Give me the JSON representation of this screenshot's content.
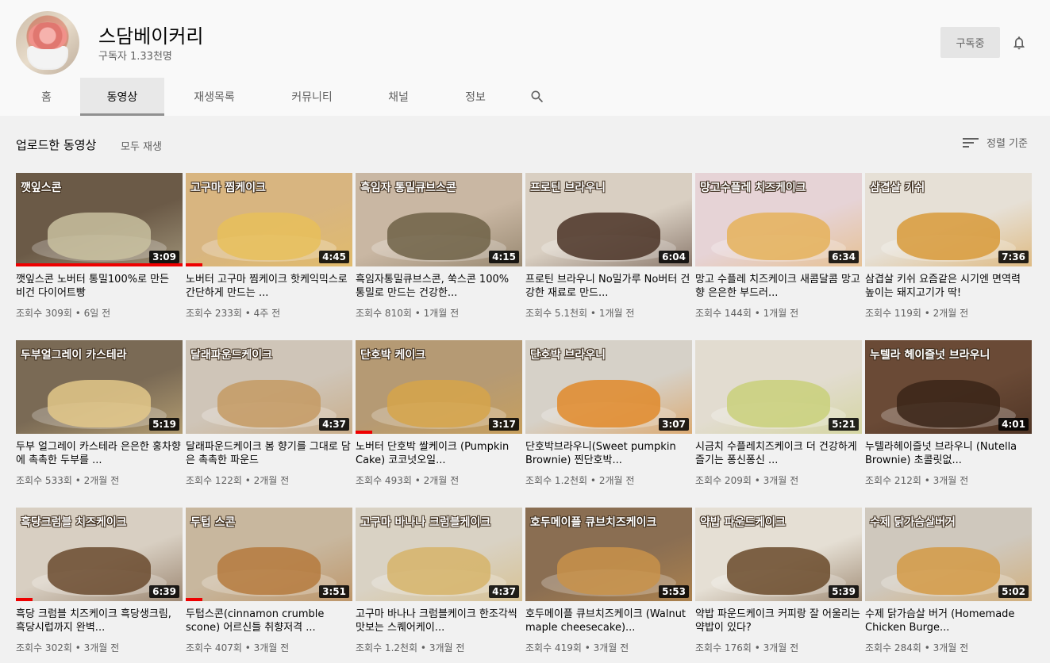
{
  "channel": {
    "name": "스담베이커리",
    "subscribers": "구독자 1.33천명",
    "subscribe_label": "구독중"
  },
  "tabs": [
    {
      "label": "홈"
    },
    {
      "label": "동영상"
    },
    {
      "label": "재생목록"
    },
    {
      "label": "커뮤니티"
    },
    {
      "label": "채널"
    },
    {
      "label": "정보"
    }
  ],
  "section": {
    "title": "업로드한 동영상",
    "play_all": "모두 재생",
    "sort_label": "정렬 기준"
  },
  "videos": [
    {
      "thumb_text": "깻잎스콘",
      "duration": "3:09",
      "progress": 1.0,
      "title": "깻잎스콘 노버터 통밀100%로 만든 비건 다이어트빵",
      "views": "조회수 309회",
      "age": "6일 전",
      "bg": "#6b5a47",
      "accent": "#c9c1a0"
    },
    {
      "thumb_text": "고구마 찜케이크",
      "duration": "4:45",
      "progress": 0.1,
      "title": "노버터 고구마 찜케이크 핫케익믹스로 간단하게 만드는 ...",
      "views": "조회수 233회",
      "age": "4주 전",
      "bg": "#d8b580",
      "accent": "#e8c05a"
    },
    {
      "thumb_text": "흑임자 통밀큐브스콘",
      "duration": "4:15",
      "progress": 0,
      "title": "흑임자통밀큐브스콘, 쑥스콘 100% 통밀로 만드는 건강한...",
      "views": "조회수 810회",
      "age": "1개월 전",
      "bg": "#c9b7a3",
      "accent": "#6f6147"
    },
    {
      "thumb_text": "프로틴 브라우니",
      "duration": "6:04",
      "progress": 0,
      "title": "프로틴 브라우니 No밀가루 No버터 건강한 재료로 만드...",
      "views": "조회수 5.1천회",
      "age": "1개월 전",
      "bg": "#d9cfc2",
      "accent": "#4a3226"
    },
    {
      "thumb_text": "망고수플레 치즈케이크",
      "duration": "6:34",
      "progress": 0,
      "title": "망고 수플레 치즈케이크 새콤달콤 망고향 은은한 부드러...",
      "views": "조회수 144회",
      "age": "1개월 전",
      "bg": "#e6d3d6",
      "accent": "#e5b15a"
    },
    {
      "thumb_text": "삼겹살 키쉬",
      "duration": "7:36",
      "progress": 0,
      "title": "삼겹살 키쉬 요즘같은 시기엔 면역력 높이는 돼지고기가 딱!",
      "views": "조회수 119회",
      "age": "2개월 전",
      "bg": "#e6e0d6",
      "accent": "#d89a3a"
    },
    {
      "thumb_text": "두부얼그레이 카스테라",
      "duration": "5:19",
      "progress": 0,
      "title": "두부 얼그레이 카스테라 은은한 홍차향에 촉촉한 두부를 ...",
      "views": "조회수 533회",
      "age": "2개월 전",
      "bg": "#7a6a55",
      "accent": "#e3c889"
    },
    {
      "thumb_text": "달래파운드케이크",
      "duration": "4:37",
      "progress": 0,
      "title": "달래파운드케이크 봄 향기를 그대로 담은 촉촉한 파운드",
      "views": "조회수 122회",
      "age": "2개월 전",
      "bg": "#cfc5b8",
      "accent": "#c49a63"
    },
    {
      "thumb_text": "단호박 케이크",
      "duration": "3:17",
      "progress": 0.1,
      "title": "노버터 단호박 쌀케이크 (Pumpkin Cake) 코코넛오일...",
      "views": "조회수 493회",
      "age": "2개월 전",
      "bg": "#b59a74",
      "accent": "#d6a44a"
    },
    {
      "thumb_text": "단호박 브라우니",
      "duration": "3:07",
      "progress": 0,
      "title": "단호박브라우니(Sweet pumpkin Brownie) 찐단호박...",
      "views": "조회수 1.2천회",
      "age": "2개월 전",
      "bg": "#d6d1c8",
      "accent": "#e08a2a"
    },
    {
      "thumb_text": "",
      "duration": "5:21",
      "progress": 0,
      "title": "시금치 수플레치즈케이크 더 건강하게 즐기는 퐁신퐁신 ...",
      "views": "조회수 209회",
      "age": "3개월 전",
      "bg": "#e2dcd0",
      "accent": "#c9d07a"
    },
    {
      "thumb_text": "누텔라 헤이즐넛 브라우니",
      "duration": "4:01",
      "progress": 0,
      "title": "누텔라헤이즐넛 브라우니 (Nutella Brownie) 초콜릿없...",
      "views": "조회수 212회",
      "age": "3개월 전",
      "bg": "#6a4a36",
      "accent": "#3a2418"
    },
    {
      "thumb_text": "흑당크럼블 치즈케이크",
      "duration": "6:39",
      "progress": 0.1,
      "title": "흑당 크럼블 치즈케이크 흑당생크림, 흑당시럽까지 완벽...",
      "views": "조회수 302회",
      "age": "3개월 전",
      "bg": "#d8cfc2",
      "accent": "#6a4a2e"
    },
    {
      "thumb_text": "두텁 스콘",
      "duration": "3:51",
      "progress": 0.1,
      "title": "두텁스콘(cinnamon crumble scone) 어르신들 취향저격 ...",
      "views": "조회수 407회",
      "age": "3개월 전",
      "bg": "#c8b79e",
      "accent": "#b57a3d"
    },
    {
      "thumb_text": "고구마 바나나 크럼블케이크",
      "duration": "4:37",
      "progress": 0,
      "title": "고구마 바나나 크럼블케이크 한조각씩 맛보는 스퀘어케이...",
      "views": "조회수 1.2천회",
      "age": "3개월 전",
      "bg": "#d9d2c4",
      "accent": "#d6b46a"
    },
    {
      "thumb_text": "호두메이플 큐브치즈케이크",
      "duration": "5:53",
      "progress": 0,
      "title": "호두메이플 큐브치즈케이크 (Walnut maple cheesecake)...",
      "views": "조회수 419회",
      "age": "3개월 전",
      "bg": "#8a6e52",
      "accent": "#c8924a"
    },
    {
      "thumb_text": "약밥 파운드케이크",
      "duration": "5:39",
      "progress": 0,
      "title": "약밥 파운드케이크 커피랑 잘 어울리는 약밥이 있다?",
      "views": "조회수 176회",
      "age": "3개월 전",
      "bg": "#e5dfd4",
      "accent": "#6a4a2a"
    },
    {
      "thumb_text": "수제 닭가슴살버거",
      "duration": "5:02",
      "progress": 0,
      "title": "수제 닭가슴살 버거 (Homemade Chicken Burge...",
      "views": "조회수 284회",
      "age": "3개월 전",
      "bg": "#cfc8bd",
      "accent": "#d49a45"
    }
  ]
}
